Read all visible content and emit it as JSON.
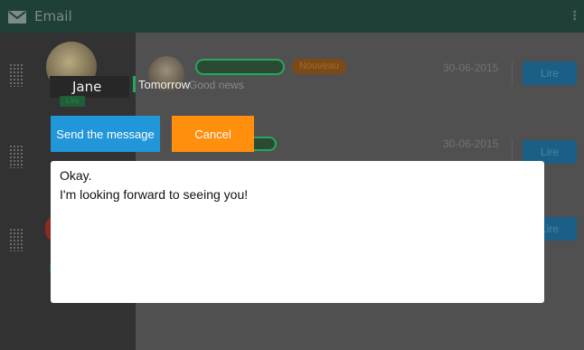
{
  "app": {
    "title": "Email",
    "title_icon": "mail-icon",
    "menu_icon": "more-vertical-icon",
    "colors": {
      "topbar": "#1f4037",
      "sidebar": "#323232",
      "content": "#505050",
      "accent_green": "#25a85e",
      "send_button": "#2196d8",
      "cancel_button": "#ff8f0d"
    }
  },
  "contact": {
    "name": "Jane",
    "subject_prefix": "Tomorrow",
    "subject_rest": "Good news"
  },
  "list": {
    "rows": [
      {
        "date": "30-06-2015",
        "action_label": "Lire",
        "badge_new": "Nouveau"
      },
      {
        "date": "30-06-2015",
        "action_label": "Lire"
      },
      {
        "action_label": "Lire"
      }
    ]
  },
  "compose": {
    "send_label": "Send the message",
    "cancel_label": "Cancel",
    "body_lines": [
      "Okay.",
      "I'm looking forward to seeing you!"
    ]
  }
}
